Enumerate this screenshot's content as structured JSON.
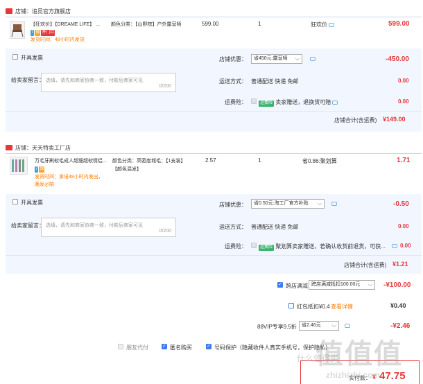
{
  "shop1": {
    "label": "店铺：",
    "name": "追觅官方旗舰店",
    "product": {
      "title": "【狂欢价】【DREAME LIFE】 ...",
      "sku": "颜色分类：【山野棕】户外露营椅",
      "badges": [
        "7",
        "保",
        "开门红"
      ],
      "ship": "发货时间：48小时内发货",
      "unit_price": "599.00",
      "qty": "1",
      "promo": "狂欢价",
      "subtotal": "599.00"
    },
    "invoice_label": "开具发票",
    "discount_label": "店铺优惠：",
    "discount_option": "省450元:露营椅",
    "discount_value": "-450.00",
    "message_label": "给卖家留言：",
    "message_placeholder": "选填，请先和商家协商一致，付款后商家可见",
    "message_count": "0/200",
    "shipping_label": "运送方式：",
    "shipping_value": "普通配送 快递 免邮",
    "shipping_price": "0.00",
    "insurance_label": "运费险：",
    "insurance_tag": "运费险",
    "insurance_text": "卖家赠送，退换货可赔",
    "insurance_price": "0.00",
    "total_label": "店铺合计(含运费)",
    "total_value": "¥149.00"
  },
  "shop2": {
    "label": "店铺：",
    "name": "天天特卖工厂店",
    "product": {
      "title": "万毛牙刷软毛成人超细超软情侣...",
      "sku": "颜色分类：高密度城毛：【1支装】【颜色混发】",
      "badges": [
        "7",
        "保"
      ],
      "ship1": "发货时间：承诺48小时内发出，",
      "ship2": "晚发必赔",
      "unit_price": "2.57",
      "qty": "1",
      "promo": "省0.86:聚划算",
      "subtotal": "1.71"
    },
    "invoice_label": "开具发票",
    "discount_label": "店铺优惠：",
    "discount_option": "省0.50元:淘工厂官方补贴",
    "discount_value": "-0.50",
    "message_label": "给卖家留言：",
    "message_placeholder": "选填，请先和商家协商一致，付款后商家可见",
    "message_count": "0/200",
    "shipping_label": "运送方式：",
    "shipping_value": "普通配送 快递 免邮",
    "shipping_price": "0.00",
    "insurance_label": "运费险：",
    "insurance_tag": "运费险",
    "insurance_text": "聚划算卖家赠送，若确认收货前退货，可获...",
    "insurance_price": "0.00",
    "total_label": "店铺合计(含运费)",
    "total_value": "¥1.21"
  },
  "summary": {
    "cross_label": "跨店满减",
    "cross_option": "跨店满减抵扣100.00元",
    "cross_value": "-¥100.00",
    "redpacket_label": "红包抵扣¥0.4",
    "redpacket_link": "查看详情",
    "redpacket_value": "¥0.40",
    "vip_label": "88VIP专享9.5折",
    "vip_option": "省2.46元",
    "vip_value": "-¥2.46",
    "anon_label": "朋友代付",
    "name_label": "匿名购买",
    "protect_label": "号码保护（隐藏收件人真实手机号，保护隐私）",
    "pay_label": "实付款：",
    "pay_currency": "¥",
    "pay_value": "47.75"
  },
  "watermark": {
    "text1": "值",
    "text2": "什么值得买",
    "url": "zhizhizhi.com"
  }
}
